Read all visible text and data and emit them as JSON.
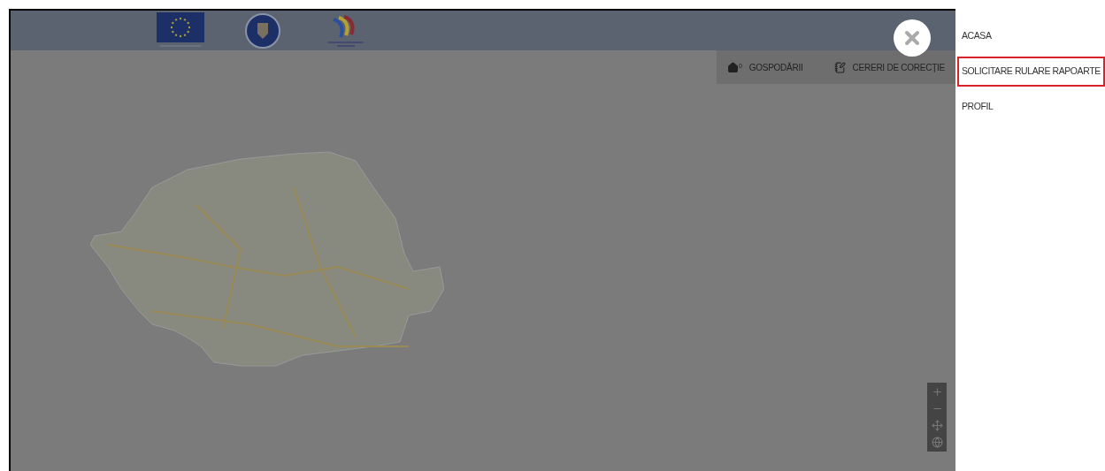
{
  "toolbar": {
    "items": [
      {
        "kind": "home",
        "label": "GOSPODĂRII",
        "badge": "0"
      },
      {
        "kind": "list",
        "label": "CERERI DE CORECȚIE"
      }
    ]
  },
  "side_menu": {
    "items": [
      {
        "label": "ACASA",
        "selected": false
      },
      {
        "label": "SOLICITARE RULARE RAPOARTE",
        "selected": true
      },
      {
        "label": "PROFIL",
        "selected": false
      }
    ]
  }
}
